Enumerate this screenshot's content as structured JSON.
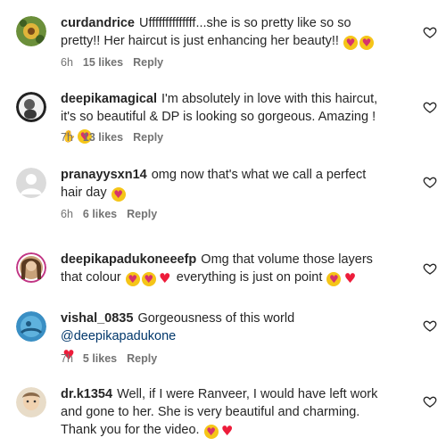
{
  "comments": [
    {
      "username": "curdandrice",
      "text_parts": [
        "Uffffffffffffff...she is so pretty like so so pretty!! Her haircut is just enhancing her beauty!! "
      ],
      "emojis": [
        "smiling-face-with-heart-eyes",
        "smiling-face-with-heart-eyes"
      ],
      "time": "6h",
      "likes": "15 likes",
      "reply": "Reply"
    },
    {
      "username": "deepikamagical",
      "text_parts": [
        "I'm absolutely in love with this haircut, it's so beautiful & DP is looking so gorgeous. Amazing ! "
      ],
      "emojis": [
        "clapping-hands",
        "smiling-face-with-heart-eyes"
      ],
      "time": "7h",
      "likes": "13 likes",
      "reply": "Reply"
    },
    {
      "username": "pranayysxn14",
      "text_parts": [
        "omg now that's what we call a perfect hair day "
      ],
      "emojis": [
        "smiling-face-with-heart-eyes"
      ],
      "time": "6h",
      "likes": "6 likes",
      "reply": "Reply"
    },
    {
      "username": "deepikapadukoneeefp",
      "text_parts": [
        "Omg that volume those layers that colour ",
        " everything is just on point "
      ],
      "emojis_a": [
        "smiling-face-with-heart-eyes",
        "smiling-face-with-heart-eyes",
        "red-heart"
      ],
      "emojis_b": [
        "smiling-face-with-heart-eyes",
        "red-heart"
      ],
      "time": null,
      "likes": null,
      "reply": null
    },
    {
      "username": "vishal_0835",
      "text_parts": [
        "Gorgeousness of this world "
      ],
      "mention": "@deepikapadukone",
      "emojis": [
        "red-heart"
      ],
      "time": "7h",
      "likes": "5 likes",
      "reply": "Reply"
    },
    {
      "username": "dr.k1354",
      "text_parts": [
        "Well, if I were Ranveer, I would have left work and gone to her. She is very beautiful and charming. Thank you for the video. "
      ],
      "emojis": [
        "smiling-face-with-heart-eyes",
        "red-heart"
      ],
      "time": null,
      "likes": null,
      "reply": null
    }
  ],
  "colors": {
    "text": "#262626",
    "secondary": "#737373",
    "mention": "#00376b",
    "heart_red": "#ed1c3a"
  }
}
